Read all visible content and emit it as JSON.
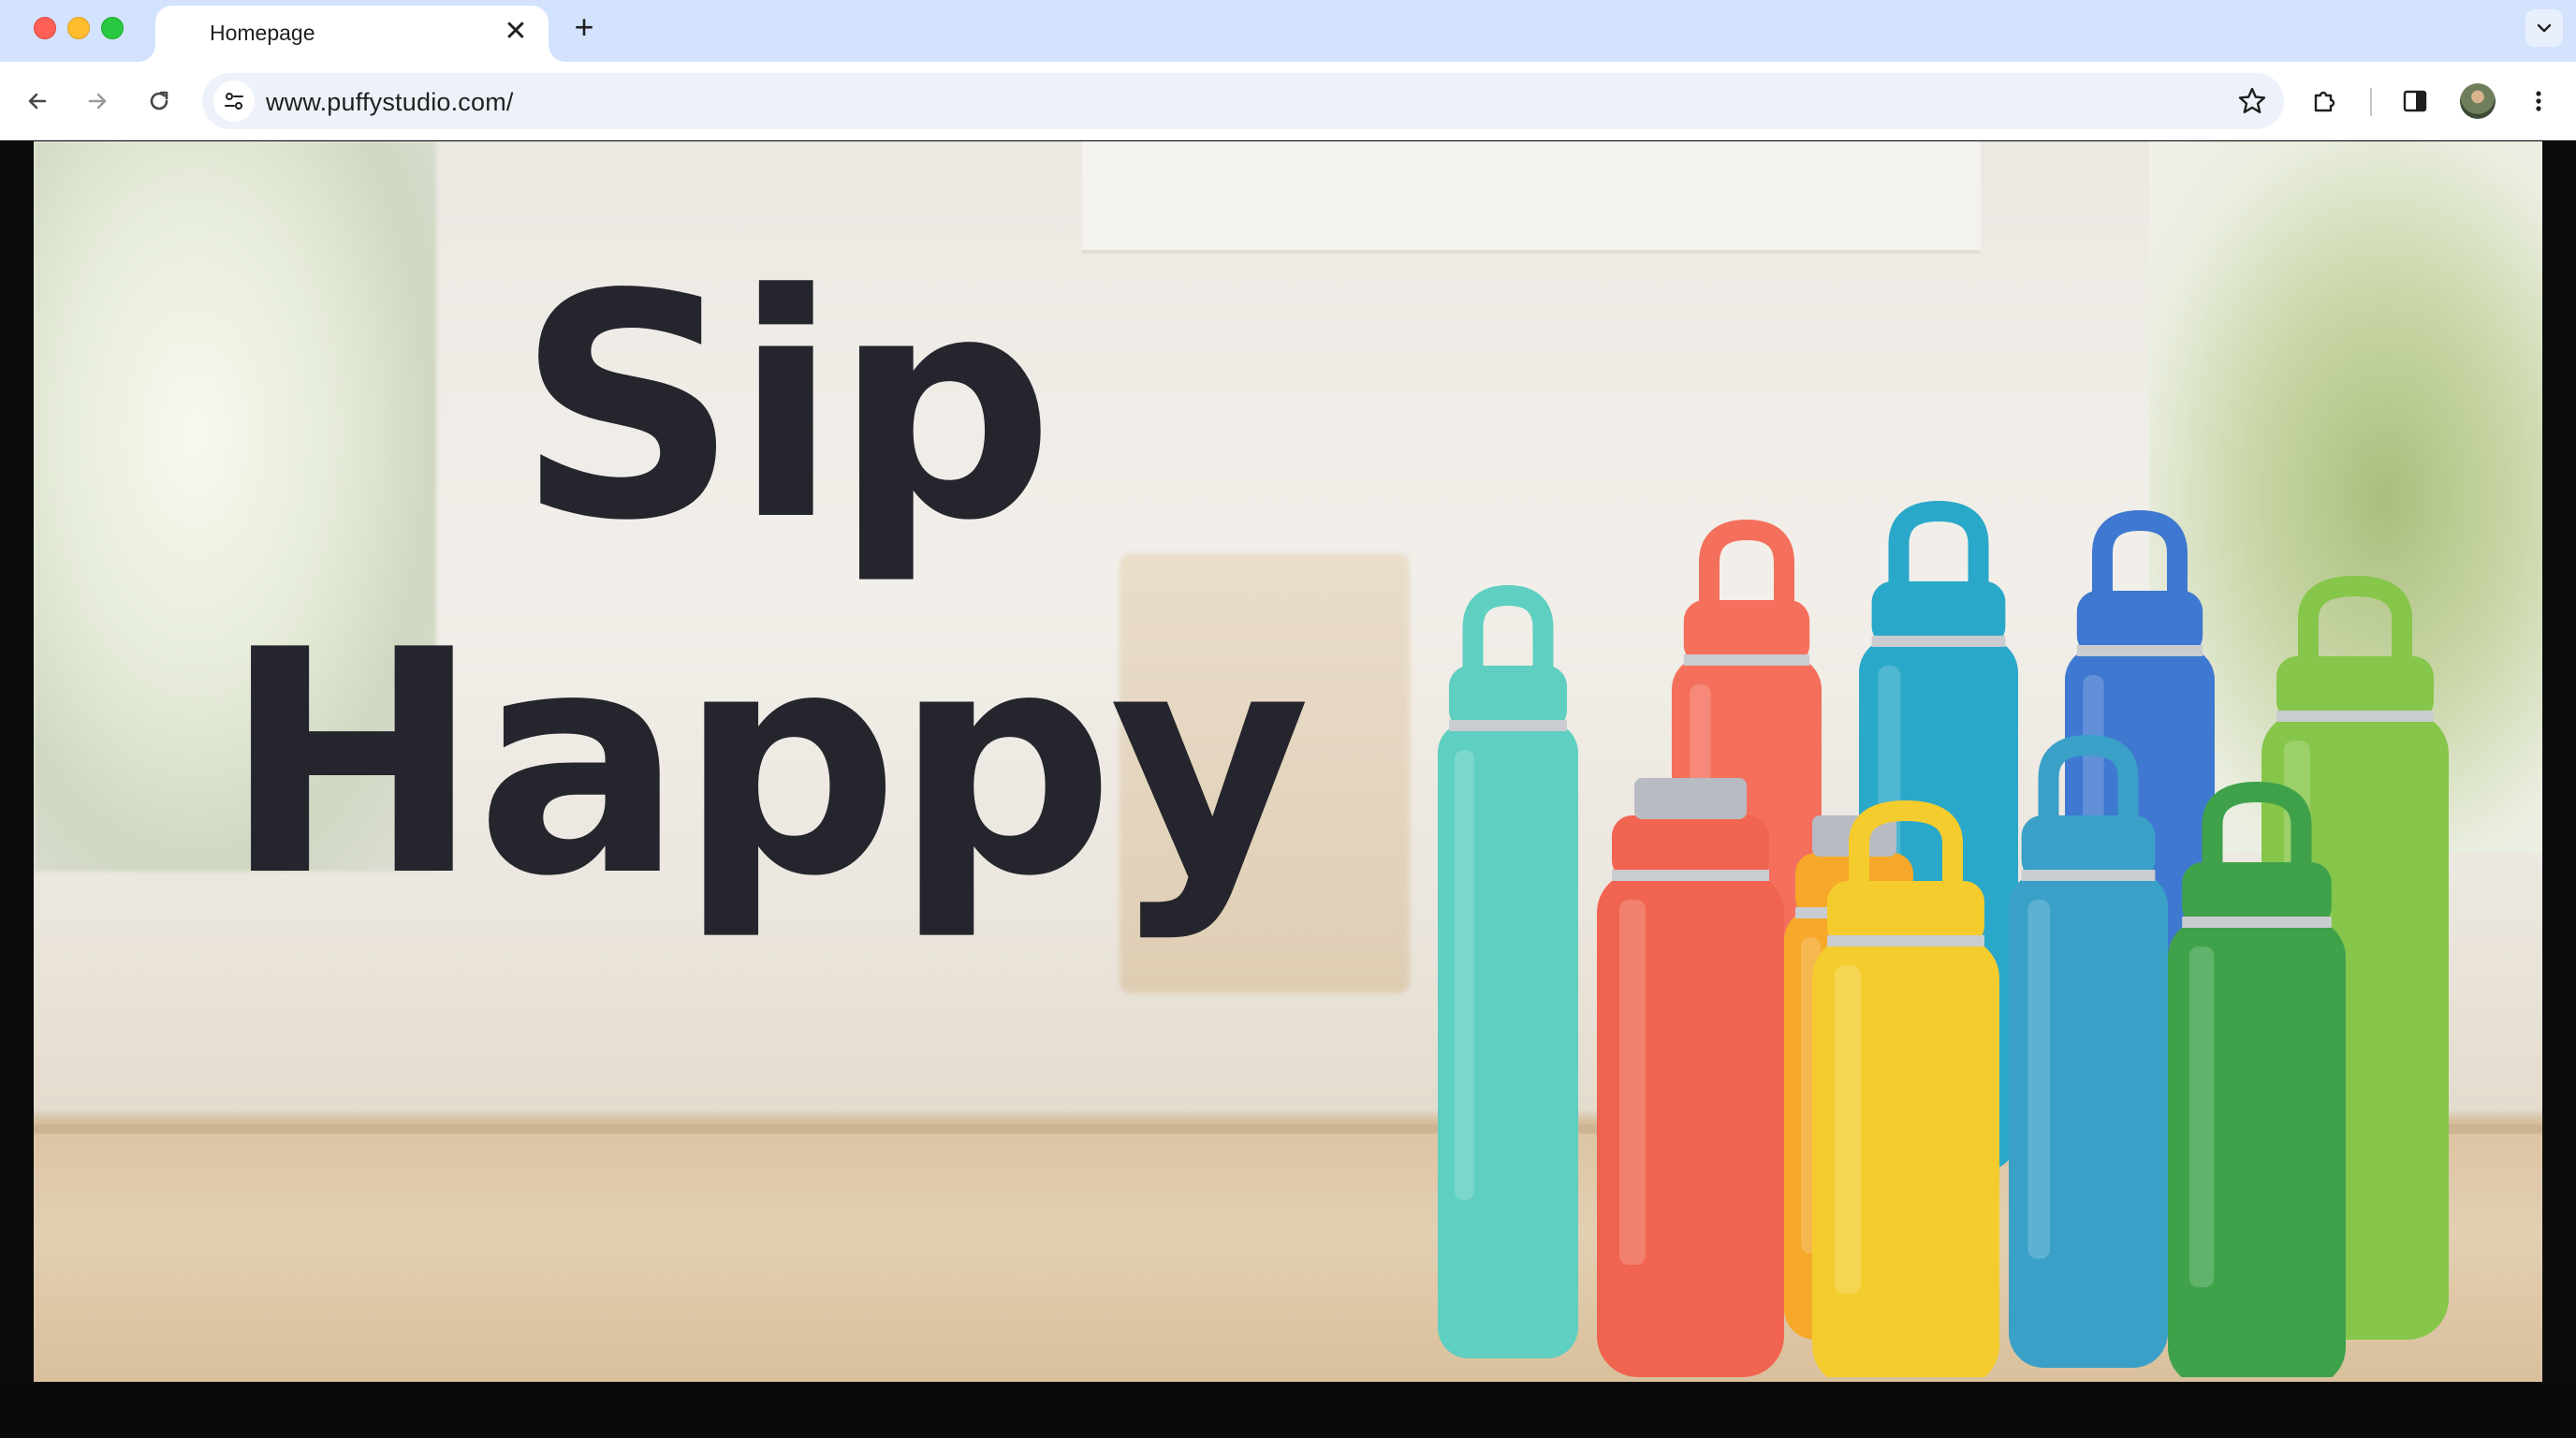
{
  "window": {
    "tab_title": "Homepage",
    "tab_close_glyph": "✕",
    "new_tab_glyph": "+"
  },
  "toolbar": {
    "url": "www.puffystudio.com/",
    "icons": [
      "back-arrow-icon",
      "forward-arrow-icon",
      "reload-icon",
      "site-info-icon",
      "bookmark-star-icon",
      "extensions-icon",
      "side-panel-icon",
      "profile-avatar",
      "more-menu-icon"
    ]
  },
  "hero": {
    "headline_line1": "Sip",
    "headline_line2": "Happy",
    "headline_color": "#25252d"
  },
  "bottles": [
    {
      "color": "#5ecfc0",
      "name": "teal"
    },
    {
      "color": "#f4705c",
      "name": "coral"
    },
    {
      "color": "#2aa8c9",
      "name": "cyan"
    },
    {
      "color": "#3f78d0",
      "name": "blue"
    },
    {
      "color": "#86c64a",
      "name": "lime"
    },
    {
      "color": "#f6a82a",
      "name": "orange"
    },
    {
      "color": "#f06450",
      "name": "red-orange"
    },
    {
      "color": "#f5cc2e",
      "name": "yellow"
    },
    {
      "color": "#3aa0c8",
      "name": "sky-blue"
    },
    {
      "color": "#3fa24b",
      "name": "green"
    }
  ]
}
